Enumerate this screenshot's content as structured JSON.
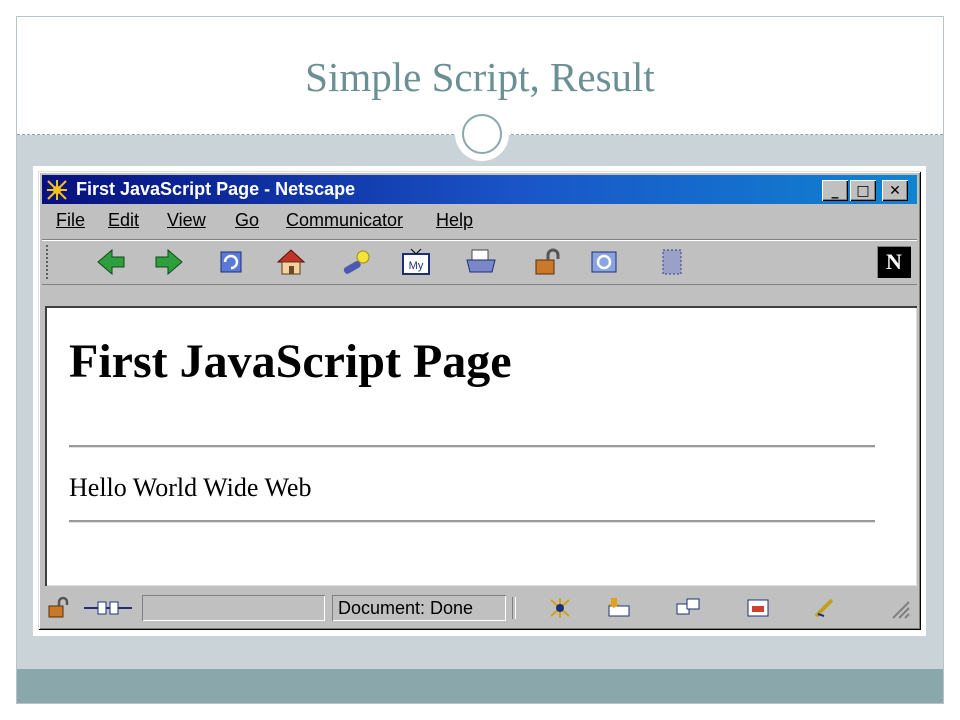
{
  "slide": {
    "title": "Simple Script, Result"
  },
  "window": {
    "title": "First JavaScript Page - Netscape",
    "caption_buttons": [
      "_",
      "□",
      "✕"
    ]
  },
  "menu": [
    "File",
    "Edit",
    "View",
    "Go",
    "Communicator",
    "Help"
  ],
  "toolbar_icons": [
    "back-icon",
    "forward-icon",
    "reload-icon",
    "home-icon",
    "search-icon",
    "my-netscape-icon",
    "print-icon",
    "security-icon",
    "shop-icon",
    "stop-icon"
  ],
  "netscape_logo": "N",
  "page": {
    "heading": "First JavaScript Page",
    "text": "Hello World Wide Web"
  },
  "status": {
    "text": "Document: Done"
  },
  "colors": {
    "titlebar": "#06107e",
    "slide_title": "#6a9094",
    "band": "#8aa8ab"
  }
}
